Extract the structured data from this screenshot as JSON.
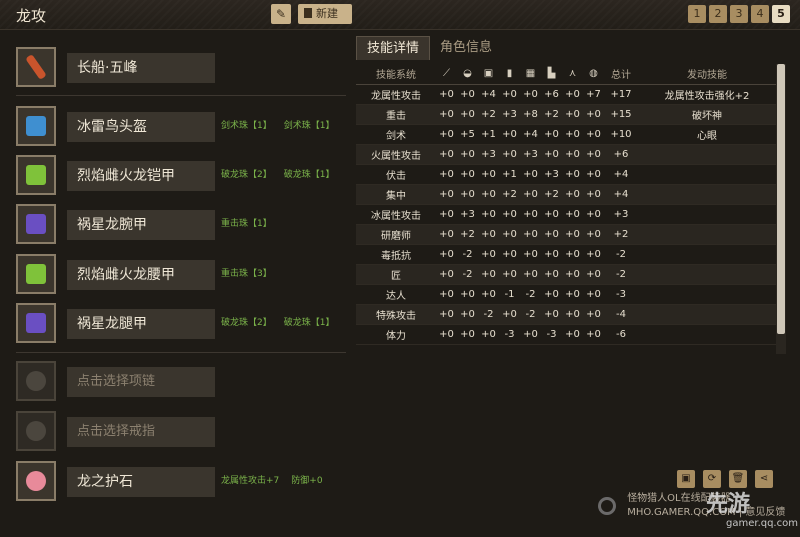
{
  "header": {
    "title": "龙攻",
    "new_label": "新建",
    "pages": [
      "1",
      "2",
      "3",
      "4",
      "5"
    ],
    "active_page": "5"
  },
  "slots": [
    {
      "name": "长船·五峰",
      "jewels": [],
      "icon": "weapon-icon",
      "color": "#c9542c"
    },
    {
      "name": "冰雷鸟头盔",
      "jewels": [
        "剑术珠【1】",
        "剑术珠【1】"
      ],
      "icon": "helmet-icon",
      "color": "#3f8fd0"
    },
    {
      "name": "烈焰雌火龙铠甲",
      "jewels": [
        "破龙珠【2】",
        "破龙珠【1】"
      ],
      "icon": "chest-armor-icon",
      "color": "#7fc23a"
    },
    {
      "name": "祸星龙腕甲",
      "jewels": [
        "重击珠【1】"
      ],
      "icon": "arm-armor-icon",
      "color": "#6a4fc2"
    },
    {
      "name": "烈焰雌火龙腰甲",
      "jewels": [
        "重击珠【3】"
      ],
      "icon": "waist-armor-icon",
      "color": "#7fc23a"
    },
    {
      "name": "祸星龙腿甲",
      "jewels": [
        "破龙珠【2】",
        "破龙珠【1】"
      ],
      "icon": "leg-armor-icon",
      "color": "#6a4fc2"
    },
    {
      "name": "点击选择项链",
      "jewels": [],
      "icon": "necklace-icon",
      "placeholder": true
    },
    {
      "name": "点击选择戒指",
      "jewels": [],
      "icon": "ring-icon",
      "placeholder": true
    },
    {
      "name": "龙之护石",
      "jewels": [
        "龙属性攻击+7",
        "防御+0"
      ],
      "icon": "talisman-icon",
      "color": "#e88a9a"
    }
  ],
  "tabs": [
    "技能详情",
    "角色信息"
  ],
  "table": {
    "headers": [
      "技能系统",
      "",
      "",
      "",
      "",
      "",
      "",
      "",
      "",
      "总计",
      "发动技能"
    ],
    "header_icons": [
      "weapon-icon",
      "helmet-icon",
      "chest-armor-icon",
      "arm-armor-icon",
      "waist-armor-icon",
      "leg-armor-icon",
      "necklace-icon",
      "ring-icon"
    ],
    "rows": [
      [
        "龙属性攻击",
        "+0",
        "+0",
        "+4",
        "+0",
        "+0",
        "+6",
        "+0",
        "+7",
        "+17",
        "龙属性攻击强化+2"
      ],
      [
        "重击",
        "+0",
        "+0",
        "+2",
        "+3",
        "+8",
        "+2",
        "+0",
        "+0",
        "+15",
        "破坏神"
      ],
      [
        "剑术",
        "+0",
        "+5",
        "+1",
        "+0",
        "+4",
        "+0",
        "+0",
        "+0",
        "+10",
        "心眼"
      ],
      [
        "火属性攻击",
        "+0",
        "+0",
        "+3",
        "+0",
        "+3",
        "+0",
        "+0",
        "+0",
        "+6",
        ""
      ],
      [
        "伏击",
        "+0",
        "+0",
        "+0",
        "+1",
        "+0",
        "+3",
        "+0",
        "+0",
        "+4",
        ""
      ],
      [
        "集中",
        "+0",
        "+0",
        "+0",
        "+2",
        "+0",
        "+2",
        "+0",
        "+0",
        "+4",
        ""
      ],
      [
        "冰属性攻击",
        "+0",
        "+3",
        "+0",
        "+0",
        "+0",
        "+0",
        "+0",
        "+0",
        "+3",
        ""
      ],
      [
        "研磨师",
        "+0",
        "+2",
        "+0",
        "+0",
        "+0",
        "+0",
        "+0",
        "+0",
        "+2",
        ""
      ],
      [
        "毒抵抗",
        "+0",
        "-2",
        "+0",
        "+0",
        "+0",
        "+0",
        "+0",
        "+0",
        "-2",
        ""
      ],
      [
        "匠",
        "+0",
        "-2",
        "+0",
        "+0",
        "+0",
        "+0",
        "+0",
        "+0",
        "-2",
        ""
      ],
      [
        "达人",
        "+0",
        "+0",
        "+0",
        "-1",
        "-2",
        "+0",
        "+0",
        "+0",
        "-3",
        ""
      ],
      [
        "特殊攻击",
        "+0",
        "+0",
        "-2",
        "+0",
        "-2",
        "+0",
        "+0",
        "+0",
        "-4",
        ""
      ],
      [
        "体力",
        "+0",
        "+0",
        "+0",
        "-3",
        "+0",
        "-3",
        "+0",
        "+0",
        "-6",
        ""
      ]
    ]
  },
  "footer": {
    "line1": "怪物猎人OL在线配装器",
    "line2": "MHO.GAMER.QQ.COM | 意见反馈",
    "watermark": "先游",
    "watermark_sub": "gamer.qq.com"
  },
  "colors": {
    "accent": "#c9b28a",
    "jewel_green": "#7bb34a",
    "background": "#1e1b16"
  }
}
